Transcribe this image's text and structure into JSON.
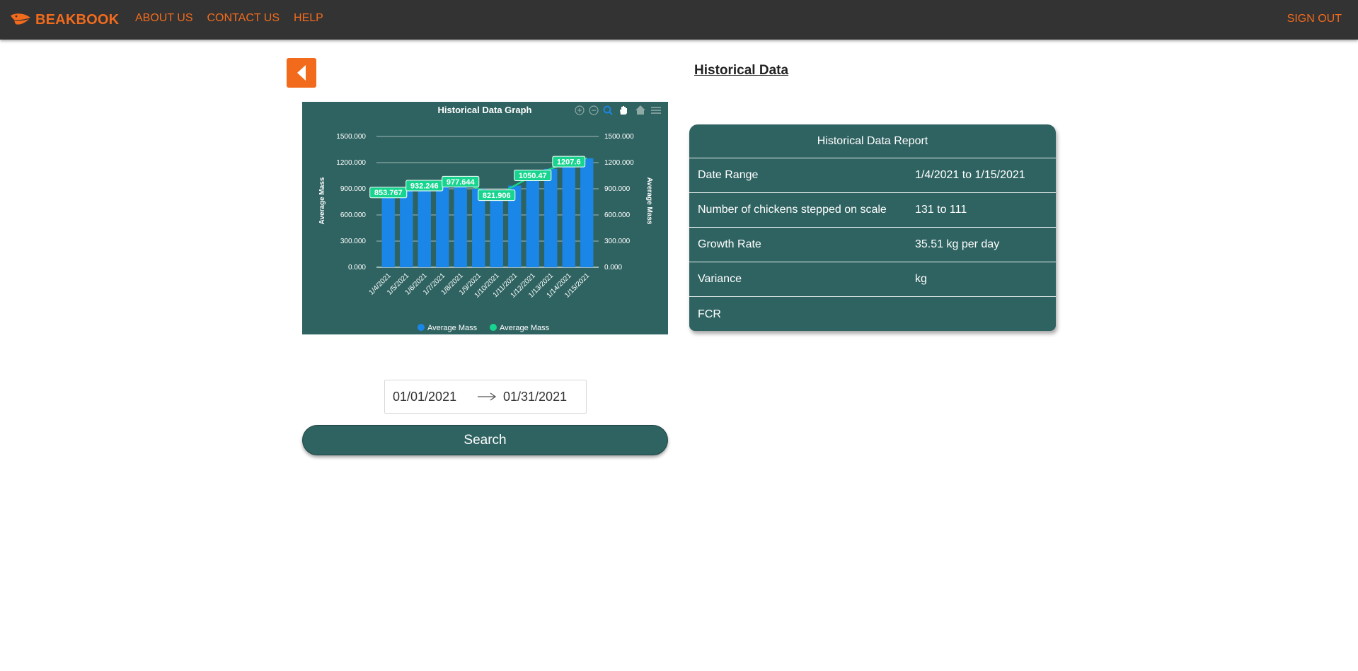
{
  "nav": {
    "brand": "BEAKBOOK",
    "links": [
      "ABOUT US",
      "CONTACT US",
      "HELP"
    ],
    "sign_out": "SIGN OUT"
  },
  "page": {
    "title": "Historical Data"
  },
  "colors": {
    "accent": "#f26b1d",
    "panel": "#2f6361",
    "bar": "#1a86e8",
    "line": "#17d58e"
  },
  "chart_data": {
    "type": "bar+line",
    "title": "Historical Data Graph",
    "categories": [
      "1/4/2021",
      "1/5/2021",
      "1/6/2021",
      "1/7/2021",
      "1/8/2021",
      "1/9/2021",
      "1/10/2021",
      "1/11/2021",
      "1/12/2021",
      "1/13/2021",
      "1/14/2021",
      "1/15/2021"
    ],
    "series": [
      {
        "name": "Average Mass",
        "type": "bar",
        "values": [
          853.767,
          893.0,
          932.246,
          955.0,
          977.644,
          900.0,
          821.906,
          936.0,
          1050.47,
          1129.0,
          1207.6,
          1250.0
        ]
      },
      {
        "name": "Average Mass",
        "type": "line",
        "values": [
          853.767,
          893.0,
          932.246,
          955.0,
          977.644,
          900.0,
          821.906,
          936.0,
          1050.47,
          1129.0,
          1207.6,
          1250.0
        ]
      }
    ],
    "data_labels": [
      {
        "index": 0,
        "text": "853.767"
      },
      {
        "index": 2,
        "text": "932.246"
      },
      {
        "index": 4,
        "text": "977.644"
      },
      {
        "index": 6,
        "text": "821.906"
      },
      {
        "index": 8,
        "text": "1050.47"
      },
      {
        "index": 10,
        "text": "1207.6"
      }
    ],
    "ylabel_left": "Average Mass",
    "ylabel_right": "Average Mass",
    "ylim": [
      0,
      1500
    ],
    "yticks": [
      "0.000",
      "300.000",
      "600.000",
      "900.000",
      "1200.000",
      "1500.000"
    ],
    "grid": true,
    "legend": "bottom",
    "toolbar_icons": [
      "zoom-in-icon",
      "zoom-out-icon",
      "zoom-select-icon",
      "pan-icon",
      "home-icon",
      "menu-icon"
    ]
  },
  "report": {
    "title": "Historical Data Report",
    "rows": [
      {
        "label": "Date Range",
        "value": "1/4/2021 to 1/15/2021"
      },
      {
        "label": "Number of chickens stepped on scale",
        "value": "131 to 111"
      },
      {
        "label": "Growth Rate",
        "value": "35.51 kg per day"
      },
      {
        "label": "Variance",
        "value": "kg"
      },
      {
        "label": "FCR",
        "value": ""
      }
    ]
  },
  "date_range": {
    "start": "01/01/2021",
    "end": "01/31/2021"
  },
  "search": {
    "label": "Search"
  }
}
